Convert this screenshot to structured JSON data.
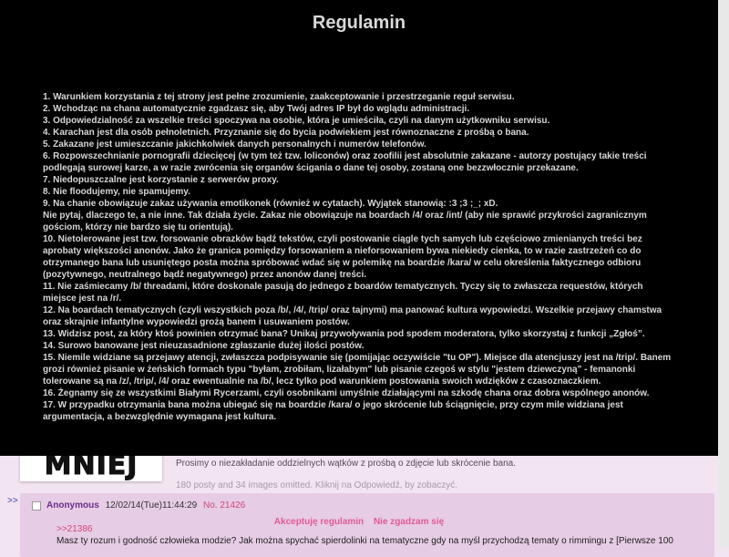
{
  "modal": {
    "title": "Regulamin",
    "rules": [
      "1. Warunkiem korzystania z tej strony jest pełne zrozumienie, zaakceptowanie i przestrzeganie reguł serwisu.",
      "2. Wchodząc na chana automatycznie zgadzasz się, aby Twój adres IP był do wglądu administracji.",
      "3. Odpowiedzialność za wszelkie treści spoczywa na osobie, która je umieściła, czyli na danym użytkowniku serwisu.",
      "4. Karachan jest dla osób pełnoletnich. Przyznanie się do bycia podwiekiem jest równoznaczne z prośbą o bana.",
      "5. Zakazane jest umieszczanie jakichkolwiek danych personalnych i numerów telefonów.",
      "6. Rozpowszechnianie pornografii dziecięcej (w tym też tzw. loliconów) oraz zoofilii jest absolutnie zakazane - autorzy postujący takie treści podlegają surowej karze, a w razie zwrócenia się organów ścigania o dane tej osoby, zostaną one bezzwłocznie przekazane.",
      "7. Niedopuszczalne jest korzystanie z serwerów proxy.",
      "8. Nie floodujemy, nie spamujemy.",
      "9. Na chanie obowiązuje zakaz używania emotikonek (również w cytatach). Wyjątek stanowią: :3 ;3 ;_; xD.",
      "Nie pytaj, dlaczego te, a nie inne. Tak działa życie. Zakaz nie obowiązuje na boardach /4/ oraz /int/ (aby nie sprawić przykrości zagranicznym gościom, którzy nie bardzo się tu orientują).",
      "10. Nietolerowane jest tzw. forsowanie obrazków bądź tekstów, czyli postowanie ciągle tych samych lub częściowo zmienianych treści bez aprobaty większości anonów. Jako że granica pomiędzy forsowaniem a nieforsowaniem bywa niekiedy cienka, to w razie zastrzeżeń co do otrzymanego bana lub usuniętego posta można spróbować wdać się w polemikę na boardzie /kara/ w celu określenia faktycznego odbioru (pozytywnego, neutralnego bądź negatywnego) przez anonów danej treści.",
      "11. Nie zaśmiecamy /b/ threadami, które doskonale pasują do jednego z boardów tematycznych. Tyczy się to zwłaszcza requestów, których miejsce jest na /r/.",
      "12. Na boardach tematycznych (czyli wszystkich poza /b/, /4/, /trip/ oraz tajnymi) ma panować kultura wypowiedzi. Wszelkie przejawy chamstwa oraz skrajnie infantylne wypowiedzi grożą banem i usuwaniem postów.",
      "13. Widzisz post, za który ktoś powinien otrzymać bana? Unikaj przywoływania pod spodem moderatora, tylko skorzystaj z funkcji „Zgłoś”.",
      "14. Surowo banowane jest nieuzasadnione zgłaszanie dużej ilości postów.",
      "15. Niemile widziane są przejawy atencji, zwłaszcza podpisywanie się (pomijając oczywiście \"tu OP\"). Miejsce dla atencjuszy jest na /trip/. Banem grozi również pisanie w żeńskich formach typu \"byłam, zrobiłam, lizałabym\" lub pisanie czegoś w stylu \"jestem dziewczyną\" - femanonki tolerowane są na /z/, /trip/, /4/ oraz ewentualnie na /b/, lecz tylko pod warunkiem postowania swoich wdzięków z czasoznaczkiem.",
      "16. Żegnamy się ze wszystkimi Białymi Rycerzami, czyli osobnikami umyślnie działającymi na szkodę chana oraz dobra wspólnego anonów.",
      "17. W przypadku otrzymania bana można ubiegać się na boardzie /kara/ o jego skrócenie lub ściągnięcie, przy czym mile widziana jest argumentacja, a bezwzględnie wymagana jest kultura."
    ],
    "accept_label": "Akceptuję regulamin",
    "decline_label": "Nie zgadzam się"
  },
  "board": {
    "banner_text": "MNIEJ",
    "note_text": "Prosimy o niezakładanie oddzielnych wątków z prośbą o zdjęcie lub skrócenie bana.",
    "omitted_text": "180 posty and 34 images omitted. Kliknij na Odpowiedź, by zobaczyć.",
    "reply_arrow": ">>",
    "reply": {
      "name": "Anonymous",
      "date": "12/02/14(Tue)11:44:29",
      "number": "No. 21426",
      "quote_link": ">>21386",
      "text": "Masz ty rozum i godność człowieka modzie? Jak można spychać spierdolinki na tematyczne gdy na myśl przychodzą tematy o rimmingu z [Pierwsze 100"
    }
  },
  "colors": {
    "overlay_bg": "#000000",
    "overlay_text": "#d8d8d8",
    "action_link": "#e05a9a",
    "page_bg": "#f2e4f0",
    "reply_bg": "#e6cce4",
    "name_color": "#6a2c8c",
    "post_number": "#d0477a"
  }
}
